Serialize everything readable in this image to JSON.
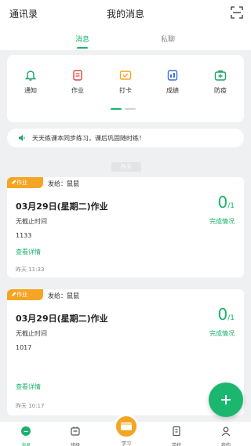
{
  "topbar": {
    "contacts": "通讯录",
    "title": "我的消息"
  },
  "tabs": {
    "messages": "消息",
    "private": "私聊"
  },
  "functions": [
    {
      "label": "通知",
      "icon": "bell-icon",
      "color": "#1aa663"
    },
    {
      "label": "作业",
      "icon": "homework-icon",
      "color": "#e0433a"
    },
    {
      "label": "打卡",
      "icon": "checkin-icon",
      "color": "#f5a524"
    },
    {
      "label": "成绩",
      "icon": "grades-icon",
      "color": "#3b6fd8"
    },
    {
      "label": "防疫",
      "icon": "medkit-icon",
      "color": "#1aa663"
    }
  ],
  "notice": "天天练课本同步练习，课后巩固随时练！",
  "date_separator": "昨天",
  "messages": [
    {
      "badge": "作业",
      "sender_prefix": "发给：",
      "sender": "鼠鼠",
      "title": "03月29日(星期二)作业",
      "deadline": "无截止时间",
      "code": "1133",
      "detail": "查看详情",
      "time": "昨天 11:33",
      "done": "0",
      "total": "/1",
      "status": "完成情况"
    },
    {
      "badge": "作业",
      "sender_prefix": "发给：",
      "sender": "鼠鼠",
      "title": "03月29日(星期二)作业",
      "deadline": "无截止时间",
      "code": "1017",
      "detail": "查看详情",
      "time": "昨天 10:17",
      "done": "0",
      "total": "/1",
      "status": "完成情况"
    }
  ],
  "bottom_nav": [
    {
      "label": "消息",
      "icon": "message-icon"
    },
    {
      "label": "班级",
      "icon": "class-icon"
    },
    {
      "label": "学习",
      "icon": "study-icon"
    },
    {
      "label": "学校",
      "icon": "school-icon"
    },
    {
      "label": "我的",
      "icon": "profile-icon"
    }
  ],
  "colors": {
    "accent": "#19b26b",
    "badge": "#f5a524"
  }
}
